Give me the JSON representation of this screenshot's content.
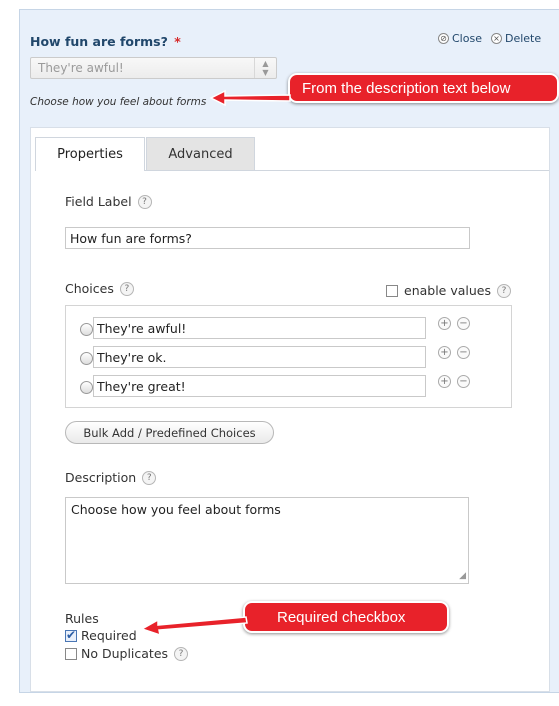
{
  "field": {
    "title": "How fun are forms?",
    "required_marker": "*",
    "close_label": "Close",
    "delete_label": "Delete",
    "preview_select_value": "They're awful!",
    "preview_description": "Choose how you feel about forms"
  },
  "callouts": {
    "description": "From the description text below",
    "required": "Required checkbox"
  },
  "tabs": [
    {
      "label": "Properties",
      "active": true
    },
    {
      "label": "Advanced",
      "active": false
    }
  ],
  "properties": {
    "field_label_heading": "Field Label",
    "field_label_value": "How fun are forms?",
    "choices_heading": "Choices",
    "enable_values_label": "enable values",
    "enable_values_checked": false,
    "choices": [
      {
        "value": "They're awful!"
      },
      {
        "value": "They're ok."
      },
      {
        "value": "They're great!"
      }
    ],
    "bulk_add_label": "Bulk Add / Predefined Choices",
    "description_heading": "Description",
    "description_value": "Choose how you feel about forms",
    "rules_heading": "Rules",
    "rules": [
      {
        "label": "Required",
        "checked": true
      },
      {
        "label": "No Duplicates",
        "checked": false
      }
    ]
  },
  "icons": {
    "help": "?",
    "add": "+",
    "remove": "−",
    "close": "⊘",
    "delete": "×"
  },
  "colors": {
    "panel_background": "#e8f0fa",
    "title_color": "#21476b",
    "required_star": "#d62a2a",
    "callout_red": "#e8222a"
  }
}
